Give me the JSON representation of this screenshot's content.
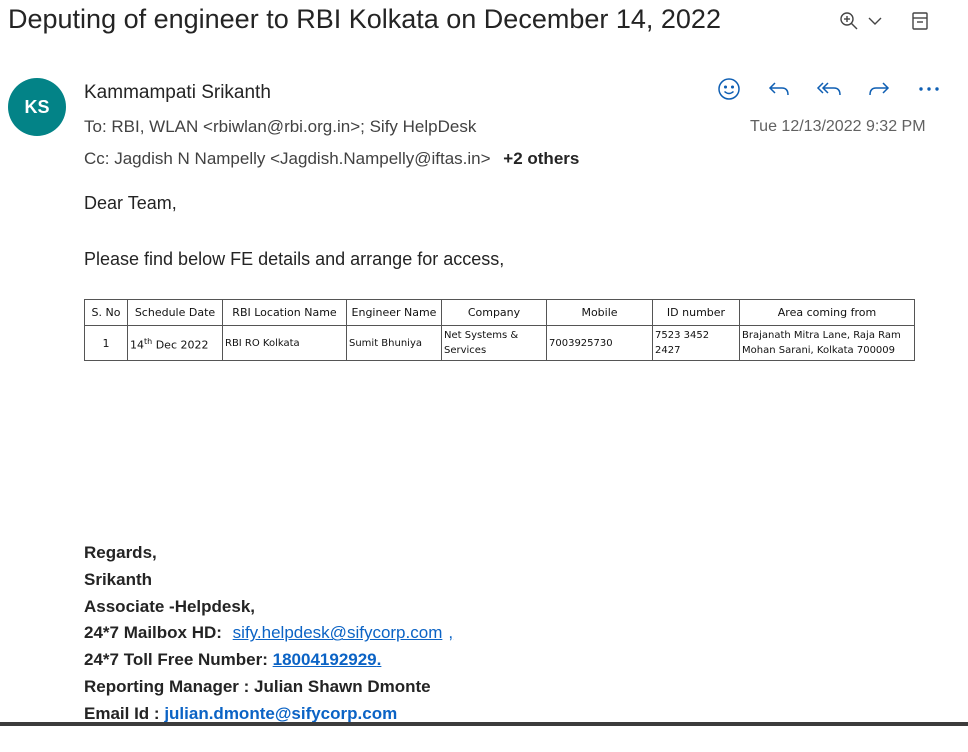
{
  "subject": "Deputing of engineer to RBI Kolkata on December 14, 2022",
  "sender": {
    "initials": "KS",
    "name": "Kammampati Srikanth",
    "avatar_color": "#038387"
  },
  "to_line": "To:  RBI, WLAN <rbiwlan@rbi.org.in>;  Sify HelpDesk",
  "cc_line": "Cc:  Jagdish N Nampelly <Jagdish.Nampelly@iftas.in>",
  "cc_more": "+2 others",
  "date": "Tue 12/13/2022 9:32 PM",
  "icons": {
    "zoom": "zoom-in-icon",
    "chevron": "chevron-down-icon",
    "window": "open-in-window-icon",
    "emoji": "emoji-react-icon",
    "reply": "reply-icon",
    "reply_all": "reply-all-icon",
    "forward": "forward-icon",
    "more": "more-actions-icon"
  },
  "body": {
    "greeting": "Dear Team,",
    "line1": "Please find below FE details and arrange for access,"
  },
  "table": {
    "headers": [
      "S. No",
      "Schedule Date",
      "RBI Location Name",
      "Engineer Name",
      "Company",
      "Mobile",
      "ID number",
      "Area coming from"
    ],
    "row": {
      "sno": "1",
      "date_day": "14",
      "date_sup": "th",
      "date_rest": " Dec 2022",
      "location": "RBI RO Kolkata",
      "engineer": "Sumit Bhuniya",
      "company": "Net Systems & Services",
      "mobile": "7003925730",
      "id_number": "7523 3452 2427",
      "area": "Brajanath Mitra Lane, Raja Ram Mohan Sarani, Kolkata 700009"
    }
  },
  "signature": {
    "regards": "Regards,",
    "name": "Srikanth",
    "title": "Associate -Helpdesk,",
    "mailbox_label": "24*7 Mailbox HD:",
    "mailbox_link": "sify.helpdesk@sifycorp.com",
    "mailbox_suffix": ",",
    "tollfree_label": "24*7 Toll Free Number:",
    "tollfree_link": "18004192929",
    "tollfree_suffix": ".",
    "manager_line": "Reporting Manager : Julian Shawn Dmonte",
    "email_label": "Email Id :",
    "email_value": "julian.dmonte@sifycorp.com"
  },
  "colors": {
    "accent": "#038387",
    "link": "#0b63c5"
  }
}
